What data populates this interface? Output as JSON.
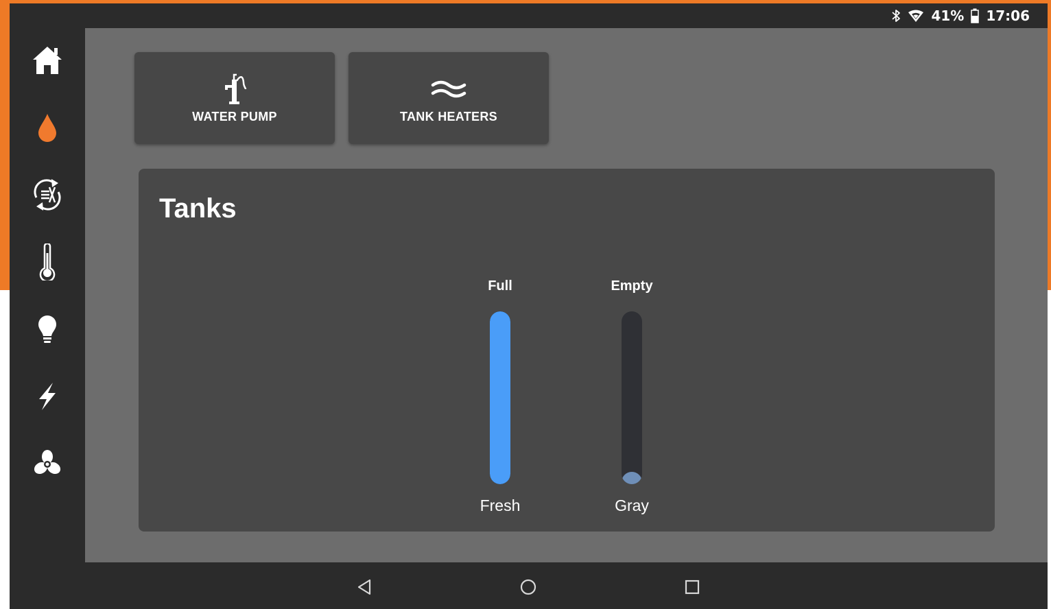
{
  "status_bar": {
    "battery_percent": "41%",
    "time": "17:06",
    "icons": [
      "bluetooth-icon",
      "wifi-icon",
      "battery-icon"
    ]
  },
  "sidebar": {
    "items": [
      {
        "icon": "home-icon",
        "active": false
      },
      {
        "icon": "water-drop-icon",
        "active": true
      },
      {
        "icon": "climate-cycle-icon",
        "active": false
      },
      {
        "icon": "thermometer-icon",
        "active": false
      },
      {
        "icon": "light-bulb-icon",
        "active": false
      },
      {
        "icon": "lightning-bolt-icon",
        "active": false
      },
      {
        "icon": "fan-icon",
        "active": false
      }
    ],
    "active_color": "#f07a2e"
  },
  "quick_buttons": [
    {
      "label": "WATER PUMP",
      "icon": "water-pump-icon"
    },
    {
      "label": "TANK HEATERS",
      "icon": "tank-heater-icon"
    }
  ],
  "tanks": {
    "title": "Tanks",
    "items": [
      {
        "name": "Fresh",
        "level_label": "Full",
        "level_fraction": 1.0,
        "color": "#4a9df8"
      },
      {
        "name": "Gray",
        "level_label": "Empty",
        "level_fraction": 0.07,
        "color": "#6f8fb8"
      }
    ]
  },
  "nav_bar": {
    "buttons": [
      "back-icon",
      "home-circle-icon",
      "recents-icon"
    ]
  },
  "colors": {
    "frame": "#ee7a26",
    "chrome": "#2b2b2b",
    "content_bg": "#6d6d6d",
    "card_bg": "#484848"
  }
}
